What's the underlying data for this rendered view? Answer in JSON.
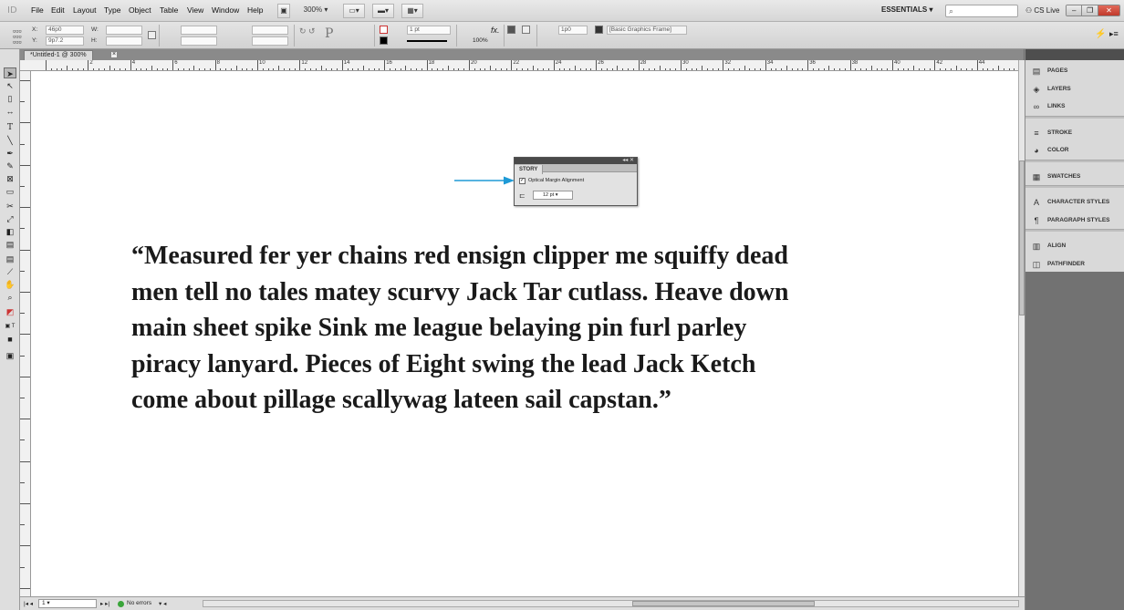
{
  "app": {
    "logo": "ID",
    "workspace": "ESSENTIALS",
    "cs_live": "CS Live",
    "zoom": "300%"
  },
  "menu": [
    "File",
    "Edit",
    "Layout",
    "Type",
    "Object",
    "Table",
    "View",
    "Window",
    "Help"
  ],
  "control": {
    "x_label": "X:",
    "x_value": "46p0",
    "y_label": "Y:",
    "y_value": "9p7.2",
    "w_label": "W:",
    "h_label": "H:",
    "stroke_weight": "1 pt",
    "opacity": "100%",
    "gap": "1p0",
    "object_style": "[Basic Graphics Frame]"
  },
  "document": {
    "tab_title": "*Untitled-1 @ 300%",
    "ruler_numbers": [
      "2",
      "4",
      "6",
      "8",
      "10",
      "12",
      "14",
      "16",
      "18",
      "20",
      "22",
      "24",
      "26",
      "28",
      "30",
      "32",
      "34",
      "36",
      "38",
      "40",
      "42",
      "44",
      "46",
      "48"
    ],
    "body_lines": [
      "“Measured fer yer chains red ensign clipper me squiffy dead",
      " men tell no tales matey scurvy Jack Tar cutlass. Heave down",
      " main sheet spike Sink me league belaying pin furl parley",
      " piracy lanyard. Pieces of Eight swing the lead Jack Ketch",
      " come about pillage scallywag lateen sail capstan.”"
    ]
  },
  "story_panel": {
    "tab": "STORY",
    "option_label": "Optical Margin Alignment",
    "option_checked": true,
    "size_value": "12 pt"
  },
  "dock": {
    "groups": [
      [
        {
          "label": "PAGES",
          "icon": "pages-icon"
        },
        {
          "label": "LAYERS",
          "icon": "layers-icon"
        },
        {
          "label": "LINKS",
          "icon": "links-icon"
        }
      ],
      [
        {
          "label": "STROKE",
          "icon": "stroke-icon"
        },
        {
          "label": "COLOR",
          "icon": "color-icon"
        }
      ],
      [
        {
          "label": "SWATCHES",
          "icon": "swatches-icon"
        }
      ],
      [
        {
          "label": "CHARACTER STYLES",
          "icon": "character-styles-icon"
        },
        {
          "label": "PARAGRAPH STYLES",
          "icon": "paragraph-styles-icon"
        }
      ],
      [
        {
          "label": "ALIGN",
          "icon": "align-icon"
        },
        {
          "label": "PATHFINDER",
          "icon": "pathfinder-icon"
        }
      ]
    ]
  },
  "status": {
    "page": "1",
    "preflight": "No errors"
  },
  "colors": {
    "arrow": "#1e9ad6",
    "page": "#ffffff",
    "pasteboard": "#6e6e6e"
  }
}
